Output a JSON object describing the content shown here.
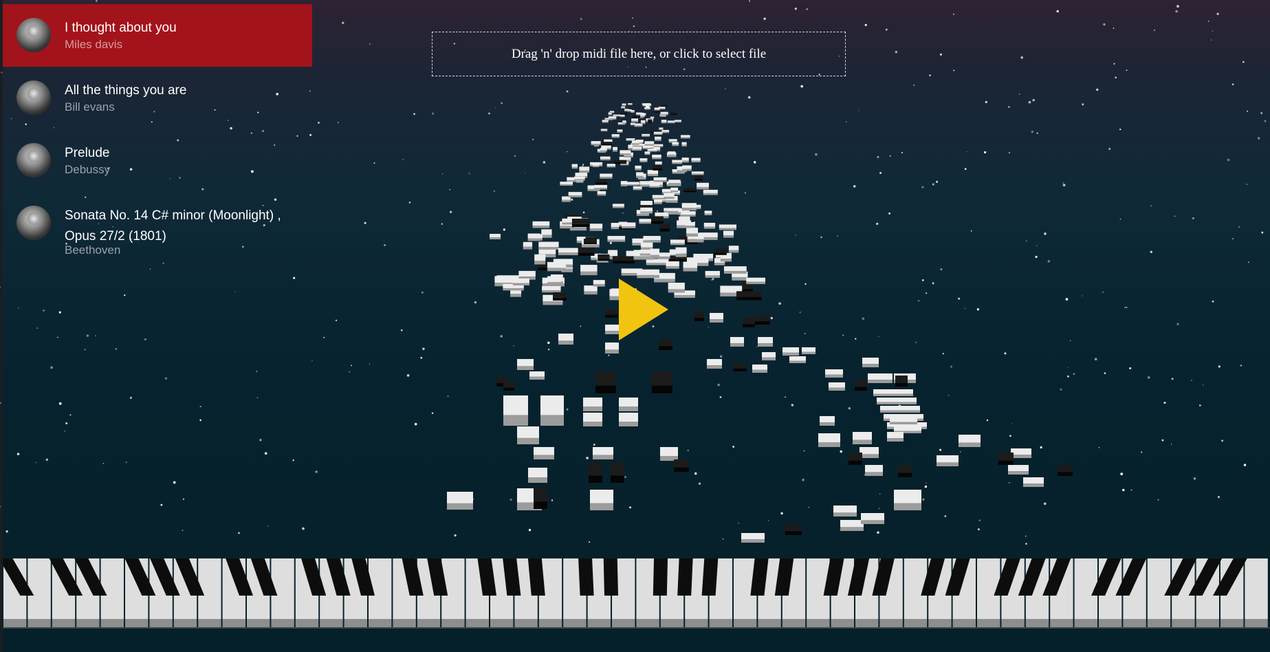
{
  "playlist": [
    {
      "title": "I thought about you",
      "artist": "Miles davis",
      "active": true
    },
    {
      "title": "All the things you are",
      "artist": "Bill evans",
      "active": false
    },
    {
      "title": "Prelude",
      "artist": "Debussy",
      "active": false
    },
    {
      "title": "Sonata No. 14 C# minor (Moonlight) , Opus 27/2 (1801)",
      "artist": "Beethoven",
      "active": false
    }
  ],
  "dropzone": {
    "label": "Drag 'n' drop midi file here, or click to select file"
  },
  "colors": {
    "active_song": "#a3131b",
    "play_button": "#f1c40f",
    "background_top": "#2e2233",
    "background_bottom": "#052028"
  },
  "icons": {
    "play": "play-triangle-icon"
  }
}
